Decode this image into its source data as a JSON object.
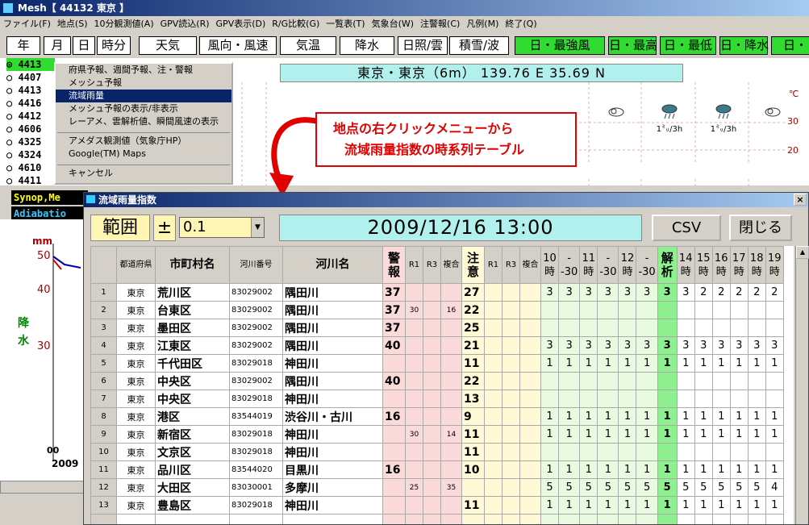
{
  "window": {
    "title": "Mesh【 44132  東京 】"
  },
  "menu": [
    "ファイル(F)",
    "地点(S)",
    "10分観測値(A)",
    "GPV読込(R)",
    "GPV表示(D)",
    "R/G比較(G)",
    "一覧表(T)",
    "気象台(W)",
    "注警報(C)",
    "凡例(M)",
    "終了(Q)"
  ],
  "tabs": [
    "年",
    "月",
    "日",
    "時分",
    "天気",
    "風向・風速",
    "気温",
    "降水",
    "日照/雲",
    "積雪/波",
    "日・最強風",
    "日・最高",
    "日・最低",
    "日・降水",
    "日・"
  ],
  "stations": [
    "⊙ 4413",
    "○ 4407",
    "○ 4413",
    "○ 4416",
    "○ 4412",
    "○ 4606",
    "○ 4325",
    "○ 4324",
    "○ 4610",
    "○ 4411"
  ],
  "station_header": "東京・東京（6m） 139.76 E   35.69 N",
  "context_menu": [
    "府県予報、週間予報、注・警報",
    "メッシュ予報",
    "流域雨量",
    "メッシュ予報の表示/非表示",
    "レーアメ、雲解析値、瞬間風速の表示",
    "アメダス観測値（気象庁HP）",
    "Google(TM) Maps",
    "キャンセル"
  ],
  "annotation": {
    "line1": "地点の右クリックメニューから",
    "line2": "流域雨量指数の時系列テーブル"
  },
  "left_labels": [
    "Synop,Me",
    "Adiabatio"
  ],
  "left_graph": {
    "unit": "mm",
    "ticks": [
      "50",
      "40",
      "30"
    ],
    "label1": "降",
    "label2": "水",
    "date_a": "00",
    "date_b": "2009"
  },
  "weather_marks": [
    {
      "text": "1㍉/3h"
    },
    {
      "text": "1㍉/3h"
    }
  ],
  "temp_ticks": {
    "unit": "℃",
    "t30": "30",
    "t20": "20"
  },
  "dialog": {
    "title": "流域雨量指数",
    "close": "×",
    "range_label": "範囲",
    "pm_label": "±",
    "range_value": "0.1",
    "datetime": "2009/12/16 13:00",
    "csv_button": "CSV",
    "close_button": "閉じる",
    "columns": [
      "都道府県",
      "市町村名",
      "河川番号",
      "河川名",
      "警報",
      "R1",
      "R3",
      "複合",
      "注意",
      "R1",
      "R3",
      "複合",
      "10時",
      "--30",
      "11時",
      "--30",
      "12時",
      "--30",
      "解析",
      "14時",
      "15時",
      "16時",
      "17時",
      "18時",
      "19時"
    ],
    "rows": [
      {
        "n": "1",
        "pref": "東京",
        "city": "荒川区",
        "code": "83029002",
        "river": "隅田川",
        "w": "37",
        "r1": "",
        "r3": "",
        "c": "",
        "a": "27",
        "r1b": "",
        "r3b": "",
        "cb": "",
        "t": [
          "3",
          "3",
          "3",
          "3",
          "3",
          "3",
          "3",
          "3",
          "2",
          "2",
          "2",
          "2",
          "2"
        ]
      },
      {
        "n": "2",
        "pref": "東京",
        "city": "台東区",
        "code": "83029002",
        "river": "隅田川",
        "w": "37",
        "r1": "30",
        "r3": "",
        "c": "16",
        "a": "22",
        "r1b": "",
        "r3b": "",
        "cb": "",
        "t": [
          "",
          "",
          "",
          "",
          "",
          "",
          "",
          "",
          "",
          "",
          "",
          "",
          ""
        ]
      },
      {
        "n": "3",
        "pref": "東京",
        "city": "墨田区",
        "code": "83029002",
        "river": "隅田川",
        "w": "37",
        "r1": "",
        "r3": "",
        "c": "",
        "a": "25",
        "r1b": "",
        "r3b": "",
        "cb": "",
        "t": [
          "",
          "",
          "",
          "",
          "",
          "",
          "",
          "",
          "",
          "",
          "",
          "",
          ""
        ]
      },
      {
        "n": "4",
        "pref": "東京",
        "city": "江東区",
        "code": "83029002",
        "river": "隅田川",
        "w": "40",
        "r1": "",
        "r3": "",
        "c": "",
        "a": "21",
        "r1b": "",
        "r3b": "",
        "cb": "",
        "t": [
          "3",
          "3",
          "3",
          "3",
          "3",
          "3",
          "3",
          "3",
          "3",
          "3",
          "3",
          "3",
          "3"
        ]
      },
      {
        "n": "5",
        "pref": "東京",
        "city": "千代田区",
        "code": "83029018",
        "river": "神田川",
        "w": "",
        "r1": "",
        "r3": "",
        "c": "",
        "a": "11",
        "r1b": "",
        "r3b": "",
        "cb": "",
        "t": [
          "1",
          "1",
          "1",
          "1",
          "1",
          "1",
          "1",
          "1",
          "1",
          "1",
          "1",
          "1",
          "1"
        ]
      },
      {
        "n": "6",
        "pref": "東京",
        "city": "中央区",
        "code": "83029002",
        "river": "隅田川",
        "w": "40",
        "r1": "",
        "r3": "",
        "c": "",
        "a": "22",
        "r1b": "",
        "r3b": "",
        "cb": "",
        "t": [
          "",
          "",
          "",
          "",
          "",
          "",
          "",
          "",
          "",
          "",
          "",
          "",
          ""
        ]
      },
      {
        "n": "7",
        "pref": "東京",
        "city": "中央区",
        "code": "83029018",
        "river": "神田川",
        "w": "",
        "r1": "",
        "r3": "",
        "c": "",
        "a": "13",
        "r1b": "",
        "r3b": "",
        "cb": "",
        "t": [
          "",
          "",
          "",
          "",
          "",
          "",
          "",
          "",
          "",
          "",
          "",
          "",
          ""
        ]
      },
      {
        "n": "8",
        "pref": "東京",
        "city": "港区",
        "code": "83544019",
        "river": "渋谷川・古川",
        "w": "16",
        "r1": "",
        "r3": "",
        "c": "",
        "a": "9",
        "r1b": "",
        "r3b": "",
        "cb": "",
        "t": [
          "1",
          "1",
          "1",
          "1",
          "1",
          "1",
          "1",
          "1",
          "1",
          "1",
          "1",
          "1",
          "1"
        ]
      },
      {
        "n": "9",
        "pref": "東京",
        "city": "新宿区",
        "code": "83029018",
        "river": "神田川",
        "w": "",
        "r1": "30",
        "r3": "",
        "c": "14",
        "a": "11",
        "r1b": "",
        "r3b": "",
        "cb": "",
        "t": [
          "1",
          "1",
          "1",
          "1",
          "1",
          "1",
          "1",
          "1",
          "1",
          "1",
          "1",
          "1",
          "1"
        ]
      },
      {
        "n": "10",
        "pref": "東京",
        "city": "文京区",
        "code": "83029018",
        "river": "神田川",
        "w": "",
        "r1": "",
        "r3": "",
        "c": "",
        "a": "11",
        "r1b": "",
        "r3b": "",
        "cb": "",
        "t": [
          "",
          "",
          "",
          "",
          "",
          "",
          "",
          "",
          "",
          "",
          "",
          "",
          ""
        ]
      },
      {
        "n": "11",
        "pref": "東京",
        "city": "品川区",
        "code": "83544020",
        "river": "目黒川",
        "w": "16",
        "r1": "",
        "r3": "",
        "c": "",
        "a": "10",
        "r1b": "",
        "r3b": "",
        "cb": "",
        "t": [
          "1",
          "1",
          "1",
          "1",
          "1",
          "1",
          "1",
          "1",
          "1",
          "1",
          "1",
          "1",
          "1"
        ]
      },
      {
        "n": "12",
        "pref": "東京",
        "city": "大田区",
        "code": "83030001",
        "river": "多摩川",
        "w": "",
        "r1": "25",
        "r3": "",
        "c": "35",
        "a": "",
        "r1b": "",
        "r3b": "",
        "cb": "",
        "t": [
          "5",
          "5",
          "5",
          "5",
          "5",
          "5",
          "5",
          "5",
          "5",
          "5",
          "5",
          "5",
          "4"
        ]
      },
      {
        "n": "13",
        "pref": "東京",
        "city": "豊島区",
        "code": "83029018",
        "river": "神田川",
        "w": "",
        "r1": "",
        "r3": "",
        "c": "",
        "a": "11",
        "r1b": "",
        "r3b": "",
        "cb": "",
        "t": [
          "1",
          "1",
          "1",
          "1",
          "1",
          "1",
          "1",
          "1",
          "1",
          "1",
          "1",
          "1",
          "1"
        ]
      }
    ]
  }
}
